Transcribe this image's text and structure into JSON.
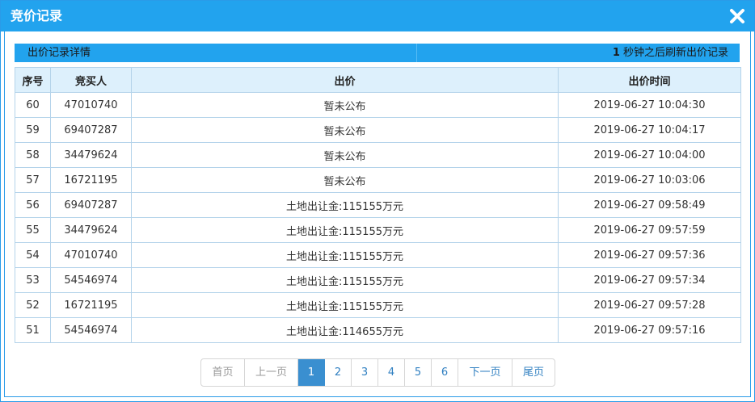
{
  "dialog": {
    "title": "竞价记录",
    "close_icon": "close-icon"
  },
  "infobar": {
    "left_text": "出价记录详情",
    "countdown_value": "1",
    "right_text": " 秒钟之后刷新出价记录"
  },
  "table": {
    "headers": [
      "序号",
      "竞买人",
      "出价",
      "出价时间"
    ],
    "rows": [
      {
        "no": "60",
        "bidder": "47010740",
        "price": "暂未公布",
        "time": "2019-06-27 10:04:30"
      },
      {
        "no": "59",
        "bidder": "69407287",
        "price": "暂未公布",
        "time": "2019-06-27 10:04:17"
      },
      {
        "no": "58",
        "bidder": "34479624",
        "price": "暂未公布",
        "time": "2019-06-27 10:04:00"
      },
      {
        "no": "57",
        "bidder": "16721195",
        "price": "暂未公布",
        "time": "2019-06-27 10:03:06"
      },
      {
        "no": "56",
        "bidder": "69407287",
        "price": "土地出让金:115155万元",
        "time": "2019-06-27 09:58:49"
      },
      {
        "no": "55",
        "bidder": "34479624",
        "price": "土地出让金:115155万元",
        "time": "2019-06-27 09:57:59"
      },
      {
        "no": "54",
        "bidder": "47010740",
        "price": "土地出让金:115155万元",
        "time": "2019-06-27 09:57:36"
      },
      {
        "no": "53",
        "bidder": "54546974",
        "price": "土地出让金:115155万元",
        "time": "2019-06-27 09:57:34"
      },
      {
        "no": "52",
        "bidder": "16721195",
        "price": "土地出让金:115155万元",
        "time": "2019-06-27 09:57:28"
      },
      {
        "no": "51",
        "bidder": "54546974",
        "price": "土地出让金:114655万元",
        "time": "2019-06-27 09:57:16"
      }
    ]
  },
  "pagination": {
    "first": "首页",
    "prev": "上一页",
    "pages": [
      "1",
      "2",
      "3",
      "4",
      "5",
      "6"
    ],
    "current": "1",
    "next": "下一页",
    "last": "尾页"
  },
  "colors": {
    "accent": "#22a3ee",
    "header_bg": "#ddf0fc",
    "active_page": "#3a8fd0",
    "link": "#2f7fc1"
  }
}
